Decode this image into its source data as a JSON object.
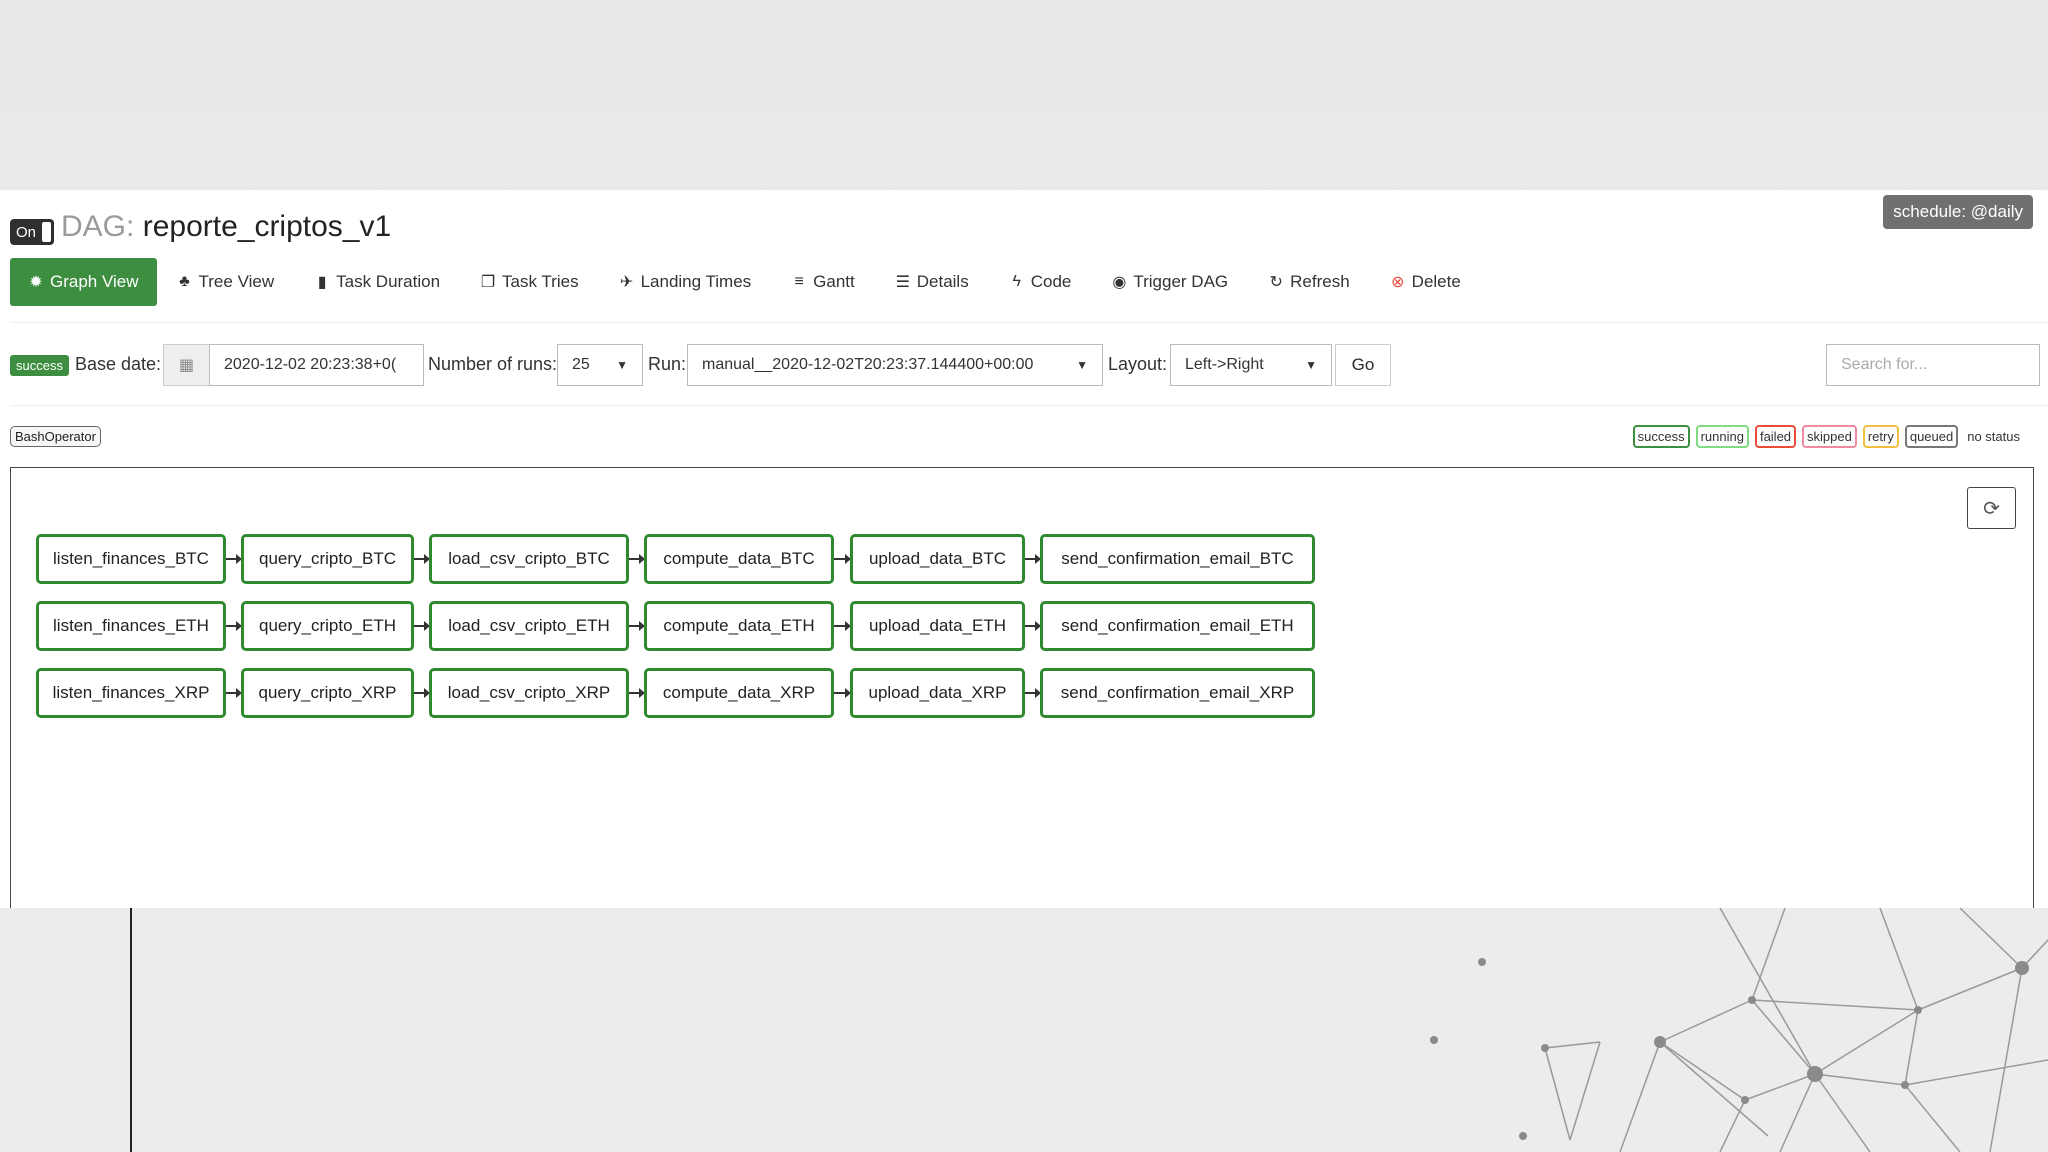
{
  "header": {
    "toggle_label": "On",
    "dag_prefix": "DAG:",
    "dag_name": "reporte_criptos_v1",
    "schedule": "schedule: @daily"
  },
  "nav": [
    {
      "label": "Graph View",
      "icon": "graph-icon"
    },
    {
      "label": "Tree View",
      "icon": "tree-icon"
    },
    {
      "label": "Task Duration",
      "icon": "bar-chart-icon"
    },
    {
      "label": "Task Tries",
      "icon": "files-icon"
    },
    {
      "label": "Landing Times",
      "icon": "plane-icon"
    },
    {
      "label": "Gantt",
      "icon": "gantt-icon"
    },
    {
      "label": "Details",
      "icon": "list-icon"
    },
    {
      "label": "Code",
      "icon": "bolt-icon"
    },
    {
      "label": "Trigger DAG",
      "icon": "play-circle-icon"
    },
    {
      "label": "Refresh",
      "icon": "refresh-icon"
    },
    {
      "label": "Delete",
      "icon": "delete-circle-icon"
    }
  ],
  "toolbar": {
    "status_badge": "success",
    "base_date_label": "Base date:",
    "base_date_value": "2020-12-02 20:23:38+0(",
    "num_runs_label": "Number of runs:",
    "num_runs_value": "25",
    "run_label": "Run:",
    "run_value": "manual__2020-12-02T20:23:37.144400+00:00",
    "layout_label": "Layout:",
    "layout_value": "Left->Right",
    "go_label": "Go",
    "search_placeholder": "Search for..."
  },
  "operator_badge": "BashOperator",
  "legend": [
    {
      "label": "success",
      "color": "#3e8e41"
    },
    {
      "label": "running",
      "color": "#7fdc7f"
    },
    {
      "label": "failed",
      "color": "#e74c3c"
    },
    {
      "label": "skipped",
      "color": "#f08aa0"
    },
    {
      "label": "retry",
      "color": "#f0c040"
    },
    {
      "label": "queued",
      "color": "#777777"
    },
    {
      "label": "no status",
      "color": ""
    }
  ],
  "graph": {
    "node_border_color": "#2f8a2f",
    "rows": [
      [
        "listen_finances_BTC",
        "query_cripto_BTC",
        "load_csv_cripto_BTC",
        "compute_data_BTC",
        "upload_data_BTC",
        "send_confirmation_email_BTC"
      ],
      [
        "listen_finances_ETH",
        "query_cripto_ETH",
        "load_csv_cripto_ETH",
        "compute_data_ETH",
        "upload_data_ETH",
        "send_confirmation_email_ETH"
      ],
      [
        "listen_finances_XRP",
        "query_cripto_XRP",
        "load_csv_cripto_XRP",
        "compute_data_XRP",
        "upload_data_XRP",
        "send_confirmation_email_XRP"
      ]
    ]
  }
}
